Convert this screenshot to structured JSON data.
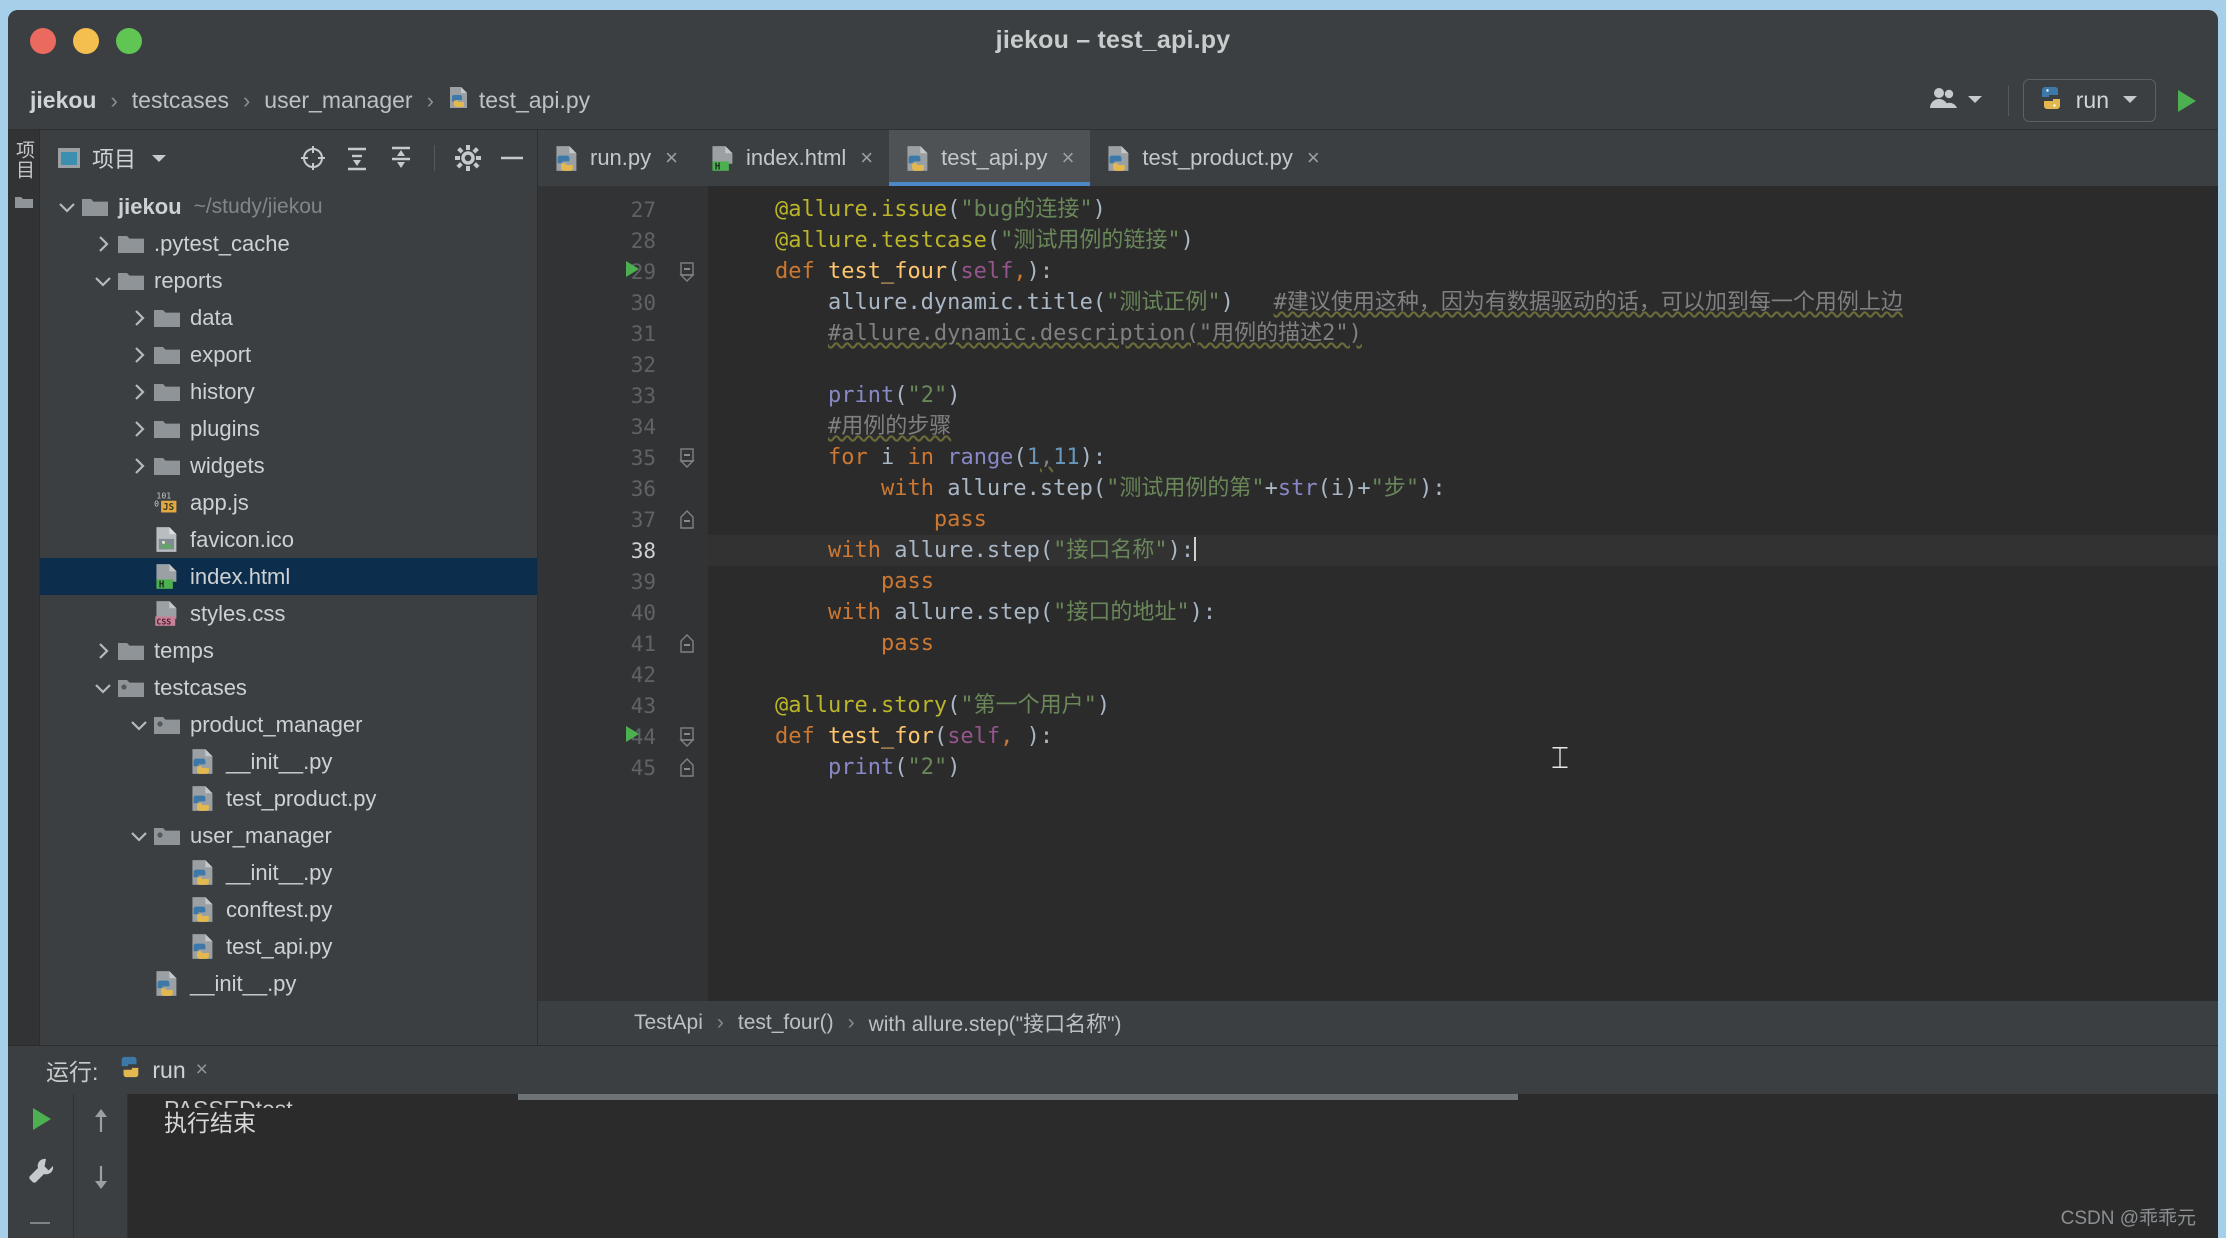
{
  "window": {
    "title": "jiekou – test_api.py",
    "traffic_lights": [
      "close",
      "minimize",
      "maximize"
    ]
  },
  "breadcrumb": {
    "items": [
      {
        "label": "jiekou",
        "icon": "none",
        "bold": true
      },
      {
        "label": "testcases",
        "icon": "none",
        "bold": false
      },
      {
        "label": "user_manager",
        "icon": "none",
        "bold": false
      },
      {
        "label": "test_api.py",
        "icon": "python-file-icon",
        "bold": false
      }
    ],
    "separator": "›"
  },
  "toolbar_right": {
    "people_icon": "people-icon",
    "people_dropdown": "chevron-down-icon",
    "run_config_label": "run",
    "run_config_icon": "python-icon",
    "run_config_dropdown": "chevron-down-icon",
    "run_button_icon": "play-icon"
  },
  "left_stripe": {
    "vertical_label": "项目",
    "folder_icon": "folder-icon"
  },
  "project_panel": {
    "title": "项目",
    "window_icon": "project-window-icon",
    "dropdown_icon": "chevron-down-icon",
    "actions": [
      {
        "name": "locate-icon",
        "glyph": "⊕"
      },
      {
        "name": "expand-all-icon",
        "glyph": "☰"
      },
      {
        "name": "collapse-all-icon",
        "glyph": "≡"
      },
      {
        "name": "settings-gear-icon",
        "glyph": "⚙"
      },
      {
        "name": "hide-panel-icon",
        "glyph": "—"
      }
    ],
    "tree": [
      {
        "label": "jiekou",
        "path": "~/study/jiekou",
        "indent": 0,
        "twisty": "down",
        "icon": "folder-icon",
        "bold": true,
        "selected": false
      },
      {
        "label": ".pytest_cache",
        "path": "",
        "indent": 1,
        "twisty": "right",
        "icon": "folder-icon",
        "bold": false,
        "selected": false
      },
      {
        "label": "reports",
        "path": "",
        "indent": 1,
        "twisty": "down",
        "icon": "folder-icon",
        "bold": false,
        "selected": false
      },
      {
        "label": "data",
        "path": "",
        "indent": 2,
        "twisty": "right",
        "icon": "folder-icon",
        "bold": false,
        "selected": false
      },
      {
        "label": "export",
        "path": "",
        "indent": 2,
        "twisty": "right",
        "icon": "folder-icon",
        "bold": false,
        "selected": false
      },
      {
        "label": "history",
        "path": "",
        "indent": 2,
        "twisty": "right",
        "icon": "folder-icon",
        "bold": false,
        "selected": false
      },
      {
        "label": "plugins",
        "path": "",
        "indent": 2,
        "twisty": "right",
        "icon": "folder-icon",
        "bold": false,
        "selected": false
      },
      {
        "label": "widgets",
        "path": "",
        "indent": 2,
        "twisty": "right",
        "icon": "folder-icon",
        "bold": false,
        "selected": false
      },
      {
        "label": "app.js",
        "path": "",
        "indent": 2,
        "twisty": "none",
        "icon": "js-file-icon",
        "bold": false,
        "selected": false
      },
      {
        "label": "favicon.ico",
        "path": "",
        "indent": 2,
        "twisty": "none",
        "icon": "image-file-icon",
        "bold": false,
        "selected": false
      },
      {
        "label": "index.html",
        "path": "",
        "indent": 2,
        "twisty": "none",
        "icon": "html-file-icon",
        "bold": false,
        "selected": true
      },
      {
        "label": "styles.css",
        "path": "",
        "indent": 2,
        "twisty": "none",
        "icon": "css-file-icon",
        "bold": false,
        "selected": false
      },
      {
        "label": "temps",
        "path": "",
        "indent": 1,
        "twisty": "right",
        "icon": "folder-icon",
        "bold": false,
        "selected": false
      },
      {
        "label": "testcases",
        "path": "",
        "indent": 1,
        "twisty": "down",
        "icon": "package-folder-icon",
        "bold": false,
        "selected": false
      },
      {
        "label": "product_manager",
        "path": "",
        "indent": 2,
        "twisty": "down",
        "icon": "package-folder-icon",
        "bold": false,
        "selected": false
      },
      {
        "label": "__init__.py",
        "path": "",
        "indent": 3,
        "twisty": "none",
        "icon": "python-file-icon",
        "bold": false,
        "selected": false
      },
      {
        "label": "test_product.py",
        "path": "",
        "indent": 3,
        "twisty": "none",
        "icon": "python-file-icon",
        "bold": false,
        "selected": false
      },
      {
        "label": "user_manager",
        "path": "",
        "indent": 2,
        "twisty": "down",
        "icon": "package-folder-icon",
        "bold": false,
        "selected": false
      },
      {
        "label": "__init__.py",
        "path": "",
        "indent": 3,
        "twisty": "none",
        "icon": "python-file-icon",
        "bold": false,
        "selected": false
      },
      {
        "label": "conftest.py",
        "path": "",
        "indent": 3,
        "twisty": "none",
        "icon": "python-file-icon",
        "bold": false,
        "selected": false
      },
      {
        "label": "test_api.py",
        "path": "",
        "indent": 3,
        "twisty": "none",
        "icon": "python-file-icon",
        "bold": false,
        "selected": false
      },
      {
        "label": "__init__.py",
        "path": "",
        "indent": 2,
        "twisty": "none",
        "icon": "python-file-icon",
        "bold": false,
        "selected": false
      }
    ]
  },
  "editor": {
    "tabs": [
      {
        "label": "run.py",
        "icon": "python-file-icon",
        "active": false,
        "close": "×"
      },
      {
        "label": "index.html",
        "icon": "html-file-icon",
        "active": false,
        "close": "×"
      },
      {
        "label": "test_api.py",
        "icon": "python-file-icon",
        "active": true,
        "close": "×"
      },
      {
        "label": "test_product.py",
        "icon": "python-file-icon",
        "active": false,
        "close": "×"
      }
    ],
    "first_line_number": 27,
    "active_line": 38,
    "lines": [
      {
        "num": 27,
        "run_marker": false,
        "fold": "",
        "active": false,
        "tokens": [
          {
            "t": "    ",
            "c": "pl"
          },
          {
            "t": "@allure.issue",
            "c": "deco"
          },
          {
            "t": "(",
            "c": "pl"
          },
          {
            "t": "\"bug的连接\"",
            "c": "str"
          },
          {
            "t": ")",
            "c": "pl"
          }
        ]
      },
      {
        "num": 28,
        "run_marker": false,
        "fold": "",
        "active": false,
        "tokens": [
          {
            "t": "    ",
            "c": "pl"
          },
          {
            "t": "@allure.testcase",
            "c": "deco"
          },
          {
            "t": "(",
            "c": "pl"
          },
          {
            "t": "\"测试用例的链接\"",
            "c": "str"
          },
          {
            "t": ")",
            "c": "pl"
          }
        ]
      },
      {
        "num": 29,
        "run_marker": true,
        "fold": "minus",
        "active": false,
        "tokens": [
          {
            "t": "    ",
            "c": "pl"
          },
          {
            "t": "def ",
            "c": "kw"
          },
          {
            "t": "test_four",
            "c": "fn"
          },
          {
            "t": "(",
            "c": "pl"
          },
          {
            "t": "self",
            "c": "self"
          },
          {
            "t": ",",
            "c": "kw"
          },
          {
            "t": "):",
            "c": "pl"
          }
        ]
      },
      {
        "num": 30,
        "run_marker": false,
        "fold": "",
        "active": false,
        "tokens": [
          {
            "t": "        ",
            "c": "pl"
          },
          {
            "t": "allure.dynamic.title",
            "c": "pl"
          },
          {
            "t": "(",
            "c": "pl"
          },
          {
            "t": "\"测试正例\"",
            "c": "str"
          },
          {
            "t": ")   ",
            "c": "pl"
          },
          {
            "t": "#建议使用这种，因为有数据驱动的话，可以加到每一个用例上边",
            "c": "cm"
          }
        ]
      },
      {
        "num": 31,
        "run_marker": false,
        "fold": "",
        "active": false,
        "tokens": [
          {
            "t": "        ",
            "c": "pl"
          },
          {
            "t": "#allure.dynamic.description(\"用例的描述2\")",
            "c": "cm"
          }
        ]
      },
      {
        "num": 32,
        "run_marker": false,
        "fold": "",
        "active": false,
        "tokens": []
      },
      {
        "num": 33,
        "run_marker": false,
        "fold": "",
        "active": false,
        "tokens": [
          {
            "t": "        ",
            "c": "pl"
          },
          {
            "t": "print",
            "c": "bi"
          },
          {
            "t": "(",
            "c": "pl"
          },
          {
            "t": "\"2\"",
            "c": "str"
          },
          {
            "t": ")",
            "c": "pl"
          }
        ]
      },
      {
        "num": 34,
        "run_marker": false,
        "fold": "",
        "active": false,
        "tokens": [
          {
            "t": "        ",
            "c": "pl"
          },
          {
            "t": "#用例的步骤",
            "c": "cm"
          }
        ]
      },
      {
        "num": 35,
        "run_marker": false,
        "fold": "minus",
        "active": false,
        "tokens": [
          {
            "t": "        ",
            "c": "pl"
          },
          {
            "t": "for ",
            "c": "kw"
          },
          {
            "t": "i ",
            "c": "pl"
          },
          {
            "t": "in ",
            "c": "kw"
          },
          {
            "t": "range",
            "c": "bi"
          },
          {
            "t": "(",
            "c": "pl"
          },
          {
            "t": "1",
            "c": "num"
          },
          {
            "t": ",",
            "c": "cm"
          },
          {
            "t": "11",
            "c": "num"
          },
          {
            "t": "):",
            "c": "pl"
          }
        ]
      },
      {
        "num": 36,
        "run_marker": false,
        "fold": "",
        "active": false,
        "tokens": [
          {
            "t": "            ",
            "c": "pl"
          },
          {
            "t": "with ",
            "c": "kw"
          },
          {
            "t": "allure.step",
            "c": "pl"
          },
          {
            "t": "(",
            "c": "pl"
          },
          {
            "t": "\"测试用例的第\"",
            "c": "str"
          },
          {
            "t": "+",
            "c": "pl"
          },
          {
            "t": "str",
            "c": "bi"
          },
          {
            "t": "(i)",
            "c": "pl"
          },
          {
            "t": "+",
            "c": "pl"
          },
          {
            "t": "\"步\"",
            "c": "str"
          },
          {
            "t": "):",
            "c": "pl"
          }
        ]
      },
      {
        "num": 37,
        "run_marker": false,
        "fold": "circle",
        "active": false,
        "tokens": [
          {
            "t": "                ",
            "c": "pl"
          },
          {
            "t": "pass",
            "c": "kw"
          }
        ]
      },
      {
        "num": 38,
        "run_marker": false,
        "fold": "",
        "active": true,
        "tokens": [
          {
            "t": "        ",
            "c": "pl"
          },
          {
            "t": "with ",
            "c": "kw"
          },
          {
            "t": "allure.step",
            "c": "pl"
          },
          {
            "t": "(",
            "c": "pl"
          },
          {
            "t": "\"接口名称\"",
            "c": "str"
          },
          {
            "t": "):",
            "c": "pl"
          }
        ],
        "cursor": true
      },
      {
        "num": 39,
        "run_marker": false,
        "fold": "",
        "active": false,
        "tokens": [
          {
            "t": "            ",
            "c": "pl"
          },
          {
            "t": "pass",
            "c": "kw"
          }
        ]
      },
      {
        "num": 40,
        "run_marker": false,
        "fold": "",
        "active": false,
        "tokens": [
          {
            "t": "        ",
            "c": "pl"
          },
          {
            "t": "with ",
            "c": "kw"
          },
          {
            "t": "allure.step",
            "c": "pl"
          },
          {
            "t": "(",
            "c": "pl"
          },
          {
            "t": "\"接口的地址\"",
            "c": "str"
          },
          {
            "t": "):",
            "c": "pl"
          }
        ]
      },
      {
        "num": 41,
        "run_marker": false,
        "fold": "circle",
        "active": false,
        "tokens": [
          {
            "t": "            ",
            "c": "pl"
          },
          {
            "t": "pass",
            "c": "kw"
          }
        ]
      },
      {
        "num": 42,
        "run_marker": false,
        "fold": "",
        "active": false,
        "tokens": []
      },
      {
        "num": 43,
        "run_marker": false,
        "fold": "",
        "active": false,
        "tokens": [
          {
            "t": "    ",
            "c": "pl"
          },
          {
            "t": "@allure.story",
            "c": "deco"
          },
          {
            "t": "(",
            "c": "pl"
          },
          {
            "t": "\"第一个用户\"",
            "c": "str"
          },
          {
            "t": ")",
            "c": "pl"
          }
        ]
      },
      {
        "num": 44,
        "run_marker": true,
        "fold": "minus",
        "active": false,
        "tokens": [
          {
            "t": "    ",
            "c": "pl"
          },
          {
            "t": "def ",
            "c": "kw"
          },
          {
            "t": "test_for",
            "c": "fn"
          },
          {
            "t": "(",
            "c": "pl"
          },
          {
            "t": "self",
            "c": "self"
          },
          {
            "t": ", ",
            "c": "kw"
          },
          {
            "t": "):",
            "c": "pl"
          }
        ]
      },
      {
        "num": 45,
        "run_marker": false,
        "fold": "circle",
        "active": false,
        "tokens": [
          {
            "t": "        ",
            "c": "pl"
          },
          {
            "t": "print",
            "c": "bi"
          },
          {
            "t": "(",
            "c": "pl"
          },
          {
            "t": "\"2\"",
            "c": "str"
          },
          {
            "t": ")",
            "c": "pl"
          }
        ]
      }
    ],
    "structure_breadcrumb": {
      "items": [
        "TestApi",
        "test_four()",
        "with allure.step(\"接口名称\")"
      ],
      "separator": "›"
    }
  },
  "run_panel": {
    "header_label": "运行:",
    "tab_label": "run",
    "tab_icon": "python-icon",
    "tab_close": "×",
    "side_actions": [
      {
        "name": "rerun-play-icon",
        "glyph": "▶"
      },
      {
        "name": "wrench-settings-icon",
        "glyph": "ὒ7"
      }
    ],
    "nav_actions": [
      {
        "name": "up-arrow-icon",
        "glyph": "↑"
      },
      {
        "name": "down-arrow-icon",
        "glyph": "↓"
      }
    ],
    "console_lines": [
      "PASSEDtest",
      "执行结束"
    ]
  },
  "watermark": "CSDN @乖乖元"
}
